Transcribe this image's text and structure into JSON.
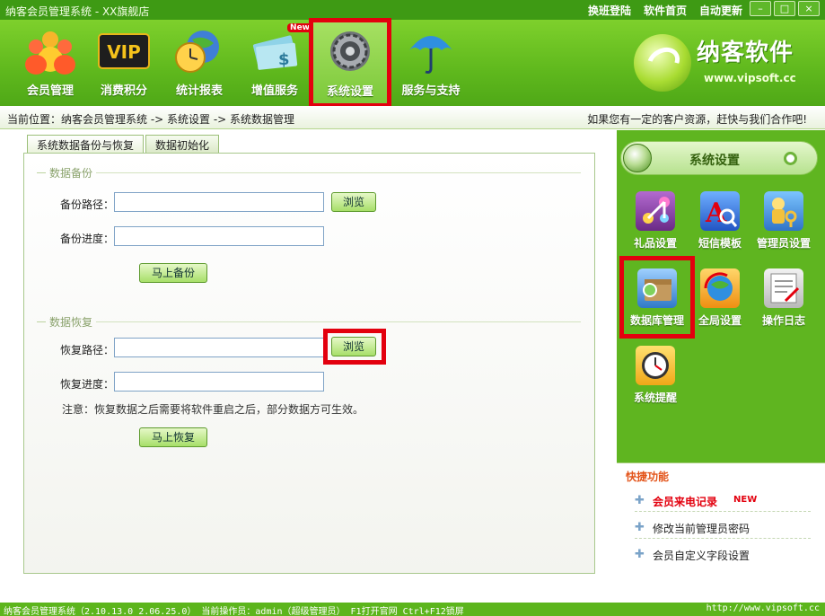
{
  "window": {
    "title": "纳客会员管理系统 - XX旗舰店",
    "links": [
      "换班登陆",
      "软件首页",
      "自动更新"
    ],
    "controls": [
      "–",
      "□",
      "×"
    ]
  },
  "toolbar": {
    "items": [
      {
        "label": "会员管理",
        "icon": "members-icon"
      },
      {
        "label": "消费积分",
        "icon": "vip-card-icon"
      },
      {
        "label": "统计报表",
        "icon": "clock-globe-icon"
      },
      {
        "label": "增值服务",
        "icon": "money-icon",
        "badge": "New"
      },
      {
        "label": "系统设置",
        "icon": "gear-icon"
      },
      {
        "label": "服务与支持",
        "icon": "umbrella-icon"
      }
    ],
    "active": "系统设置"
  },
  "brand": {
    "name": "纳客软件",
    "url": "www.vipsoft.cc"
  },
  "breadcrumb": {
    "path": "当前位置：纳客会员管理系统 -> 系统设置 -> 系统数据管理",
    "promo": "如果您有一定的客户资源，赶快与我们合作吧!"
  },
  "tabs": [
    {
      "label": "系统数据备份与恢复",
      "active": true
    },
    {
      "label": "数据初始化",
      "active": false
    }
  ],
  "backup": {
    "section": "数据备份",
    "path_label": "备份路径：",
    "path_value": "",
    "browse": "浏览",
    "progress_label": "备份进度：",
    "progress_value": "",
    "action": "马上备份"
  },
  "restore": {
    "section": "数据恢复",
    "path_label": "恢复路径：",
    "path_value": "",
    "browse": "浏览",
    "progress_label": "恢复进度：",
    "progress_value": "",
    "note": "注意：恢复数据之后需要将软件重启之后，部分数据方可生效。",
    "action": "马上恢复"
  },
  "sidebar": {
    "title": "系统设置",
    "items": [
      {
        "label": "礼品设置",
        "icon": "gift-icon",
        "color": "#8a3fa0"
      },
      {
        "label": "短信模板",
        "icon": "sms-template-icon",
        "color": "#2f6fd1"
      },
      {
        "label": "管理员设置",
        "icon": "admin-key-icon",
        "color": "#3a86d6"
      },
      {
        "label": "数据库管理",
        "icon": "database-icon",
        "color": "#3c8ccf"
      },
      {
        "label": "全局设置",
        "icon": "global-settings-icon",
        "color": "#f0a020"
      },
      {
        "label": "操作日志",
        "icon": "log-icon",
        "color": "#c9c9c9"
      },
      {
        "label": "系统提醒",
        "icon": "reminder-clock-icon",
        "color": "#f1b91c"
      }
    ]
  },
  "quick": {
    "title": "快捷功能",
    "items": [
      {
        "label": "会员来电记录",
        "badge": "NEW"
      },
      {
        "label": "修改当前管理员密码"
      },
      {
        "label": "会员自定义字段设置"
      }
    ]
  },
  "status": {
    "left": "纳客会员管理系统（2.10.13.0_2.06.25.0） 当前操作员：admin（超级管理员） F1打开官网 Ctrl+F12锁屏",
    "right": "http://www.vipsoft.cc"
  }
}
